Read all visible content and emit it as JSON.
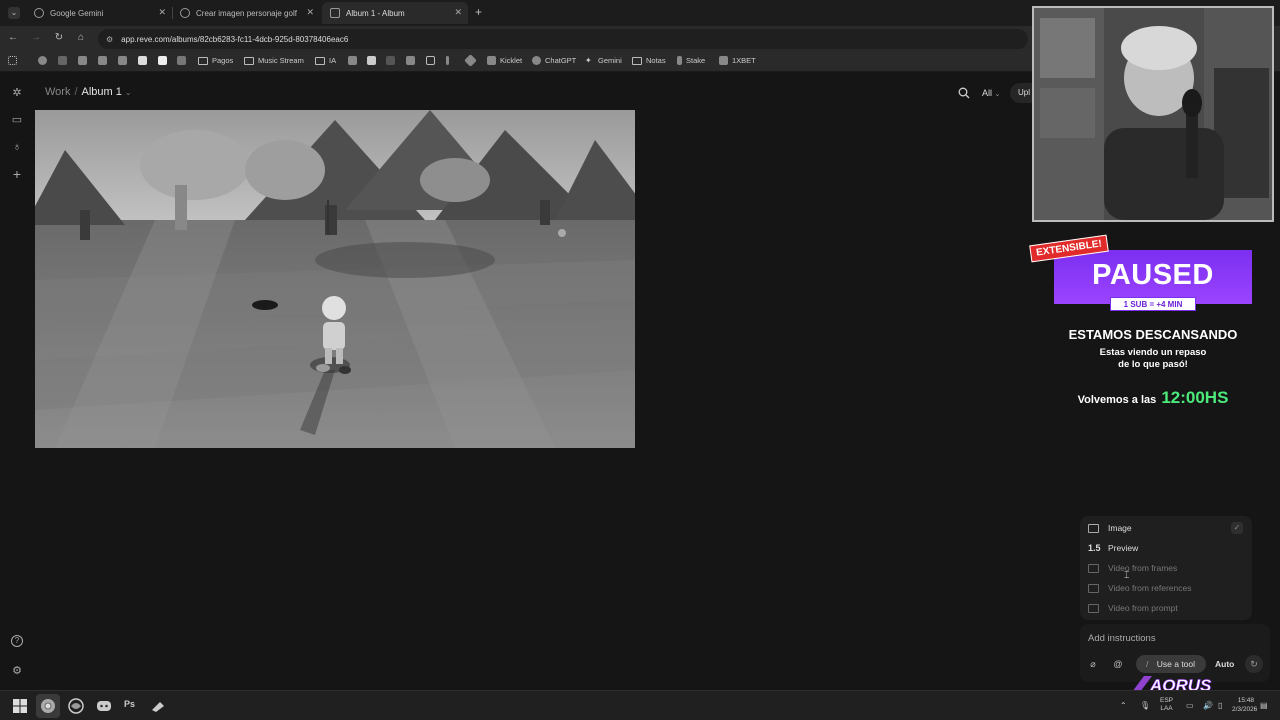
{
  "browser": {
    "tabs": [
      {
        "title": "Google Gemini",
        "active": false
      },
      {
        "title": "Crear imagen personaje golf",
        "active": false
      },
      {
        "title": "Album 1 - Album",
        "active": true
      }
    ],
    "new_tab": "+",
    "url": "app.reve.com/albums/82cb6283-fc11-4dcb-925d-80378406eac6",
    "bookmarks": [
      {
        "label": "Pagos",
        "type": "folder"
      },
      {
        "label": "Music Stream",
        "type": "folder"
      },
      {
        "label": "IA",
        "type": "folder"
      },
      {
        "label": "Kicklet",
        "type": "site"
      },
      {
        "label": "ChatGPT",
        "type": "site"
      },
      {
        "label": "Gemini",
        "type": "site"
      },
      {
        "label": "Notas",
        "type": "folder"
      },
      {
        "label": "Stake",
        "type": "site"
      },
      {
        "label": "1XBET",
        "type": "site"
      }
    ]
  },
  "app": {
    "breadcrumb": {
      "parent": "Work",
      "separator": "/",
      "current": "Album 1"
    },
    "filter_label": "All",
    "upload_label": "Upl"
  },
  "overlay": {
    "badge": "EXTENSIBLE!",
    "paused": "PAUSED",
    "sub_rule": "1 SUB = +4 MIN",
    "title": "ESTAMOS DESCANSANDO",
    "subtitle_line1": "Estas viendo un repaso",
    "subtitle_line2": "de lo que pasó!",
    "back_prefix": "Volvemos a las",
    "back_time": "12:00HS",
    "brand": "AORUS"
  },
  "tool_menu": {
    "items": [
      {
        "label": "Image",
        "icon": "image-icon",
        "enabled": true,
        "checked": true
      },
      {
        "label": "Preview",
        "icon": "version-1.5",
        "prefix": "1.5",
        "enabled": true
      },
      {
        "label": "Video from frames",
        "icon": "video-frames-icon",
        "enabled": false
      },
      {
        "label": "Video from references",
        "icon": "video-references-icon",
        "enabled": false
      },
      {
        "label": "Video from prompt",
        "icon": "video-prompt-icon",
        "enabled": false
      }
    ]
  },
  "composer": {
    "placeholder": "Add instructions",
    "use_tool": "Use a tool",
    "mode": "Auto"
  },
  "taskbar": {
    "lang_line1": "ESP",
    "lang_line2": "LAA",
    "time": "15:48",
    "date": "2/3/2026",
    "apps": [
      "windows-start-icon",
      "chrome-icon",
      "browser-icon",
      "discord-icon",
      "photoshop-icon",
      "steam-icon"
    ],
    "ps_label": "Ps"
  },
  "colors": {
    "accent_purple": "#8a3cf7",
    "badge_red": "#e12b2b",
    "time_green": "#4bea7a"
  }
}
